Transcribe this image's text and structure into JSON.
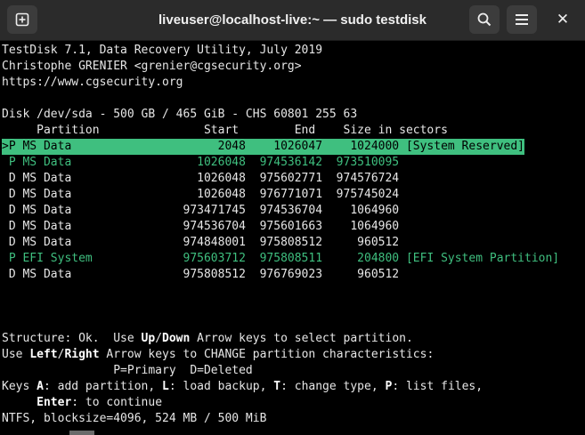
{
  "window": {
    "title": "liveuser@localhost-live:~ — sudo testdisk"
  },
  "icons": {
    "new_tab": "new-tab-icon",
    "search": "search-icon",
    "menu": "hamburger-menu-icon",
    "close": "close-icon"
  },
  "colors": {
    "titlebar": "#2b2b2b",
    "terminal_bg": "#000000",
    "text": "#e6e6e6",
    "green": "#3fbf7f"
  },
  "header": {
    "line1": "TestDisk 7.1, Data Recovery Utility, July 2019",
    "line2": "Christophe GRENIER <grenier@cgsecurity.org>",
    "line3": "https://www.cgsecurity.org"
  },
  "disk_info": "Disk /dev/sda - 500 GB / 465 GiB - CHS 60801 255 63",
  "table_header": "     Partition               Start        End    Size in sectors",
  "partitions": [
    ">P MS Data                     2048    1026047    1024000 [System Reserved]",
    " P MS Data                  1026048  974536142  973510095",
    " D MS Data                  1026048  975602771  974576724",
    " D MS Data                  1026048  976771071  975745024",
    " D MS Data                973471745  974536704    1064960",
    " D MS Data                974536704  975601663    1064960",
    " D MS Data                974848001  975808512     960512",
    " P EFI System             975603712  975808511     204800 [EFI System Partition]",
    " D MS Data                975808512  976769023     960512"
  ],
  "footer": {
    "structure_pre": "Structure: Ok.  Use ",
    "up": "Up",
    "slash1": "/",
    "down": "Down",
    "structure_post": " Arrow keys to select partition.",
    "use_pre": "Use ",
    "left": "Left",
    "slash2": "/",
    "right": "Right",
    "use_post": " Arrow keys to CHANGE partition characteristics:",
    "legend": "                P=Primary  D=Deleted",
    "keys_pre": "Keys ",
    "key_a": "A",
    "keys_a_desc": ": add partition, ",
    "key_l": "L",
    "keys_l_desc": ": load backup, ",
    "key_t": "T",
    "keys_t_desc": ": change type, ",
    "key_p": "P",
    "keys_p_desc": ": list files,",
    "enter_pre": "     ",
    "enter": "Enter",
    "enter_desc": ": to continue",
    "status": "NTFS, blocksize=4096, 524 MB / 500 MiB"
  }
}
